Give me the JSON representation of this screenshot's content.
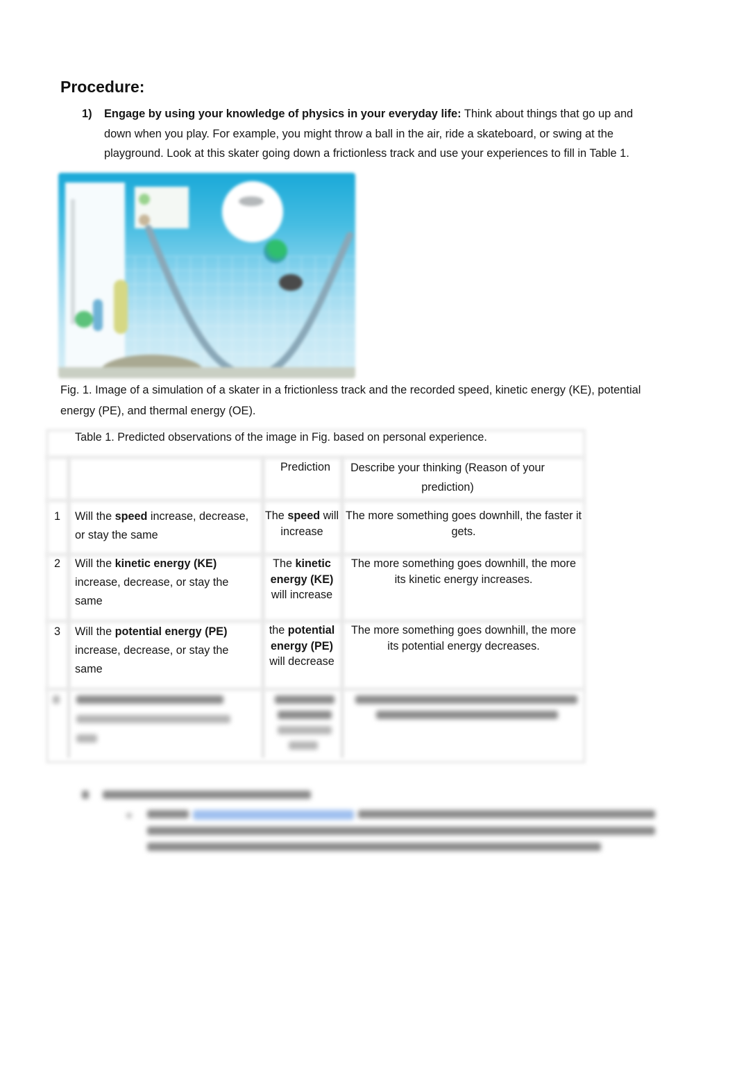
{
  "document": {
    "heading": "Procedure:",
    "steps": [
      {
        "number": "1)",
        "bold_lead": "Engage by using your knowledge of physics in your everyday life:",
        "text": " Think about things that go up and down when you play. For example, you might throw a ball in the air, ride a skateboard, or swing at the playground. Look at this skater going down a frictionless track and use your experiences to fill in Table 1."
      }
    ],
    "figure": {
      "image_description": "skate-park-simulation",
      "caption": "Fig. 1. Image of a simulation of a skater in a frictionless track and the recorded speed, kinetic energy (KE), potential energy (PE), and thermal energy (OE)."
    },
    "table": {
      "title": "Table 1. Predicted observations of the image in Fig. based on personal experience.",
      "headers": {
        "number": "",
        "question": "",
        "prediction": "Prediction",
        "reasoning": "Describe your thinking (Reason of your prediction)"
      },
      "rows": [
        {
          "number": "1",
          "question_pre": "Will the ",
          "question_bold": "speed",
          "question_post": " increase, decrease, or stay the same",
          "prediction_pre": "The ",
          "prediction_bold": "speed",
          "prediction_post": " will increase",
          "reasoning": "The more something goes downhill, the faster it gets."
        },
        {
          "number": "2",
          "question_pre": "Will the ",
          "question_bold": "kinetic energy (KE)",
          "question_post": " increase, decrease, or stay the same",
          "prediction_pre": "The ",
          "prediction_bold": "kinetic energy (KE)",
          "prediction_post": " will increase",
          "reasoning": "The more something goes downhill, the more its kinetic energy increases."
        },
        {
          "number": "3",
          "question_pre": "Will the ",
          "question_bold": "potential energy (PE)",
          "question_post": " increase, decrease, or stay the same",
          "prediction_pre": "the ",
          "prediction_bold": "potential energy (PE)",
          "prediction_post": " will decrease",
          "reasoning": "The more something goes downhill, the more its potential energy decreases."
        },
        {
          "number": "",
          "obscured": true
        }
      ]
    },
    "obscured_section": {
      "note": "content blurred / not legible"
    }
  }
}
